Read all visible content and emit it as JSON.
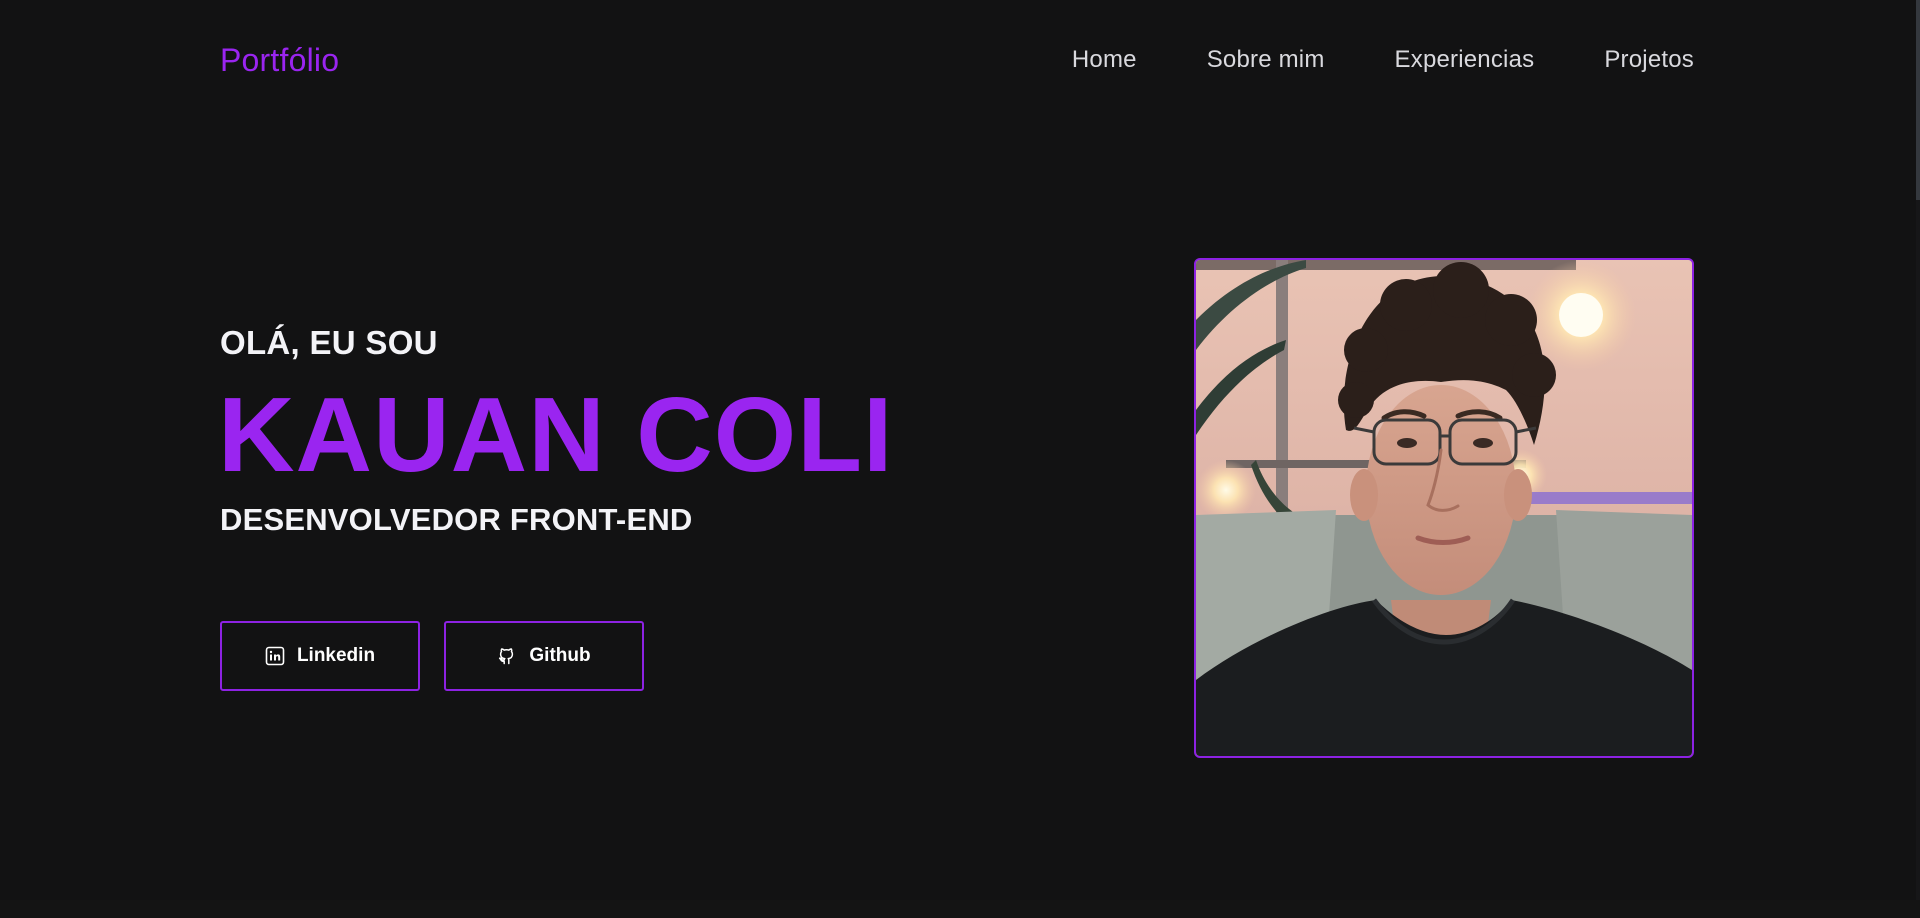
{
  "nav": {
    "brand": "Portfólio",
    "links": [
      {
        "label": "Home"
      },
      {
        "label": "Sobre mim"
      },
      {
        "label": "Experiencias"
      },
      {
        "label": "Projetos"
      }
    ]
  },
  "hero": {
    "greeting": "OLÁ, EU SOU",
    "name": "KAUAN COLI",
    "role": "DESENVOLVEDOR FRONT-END",
    "buttons": [
      {
        "label": "Linkedin",
        "icon": "linkedin-icon"
      },
      {
        "label": "Github",
        "icon": "github-icon"
      }
    ],
    "photo": {
      "icon": "profile-photo"
    }
  },
  "colors": {
    "background": "#121213",
    "accent": "#9a25f0",
    "text": "#f3f3f7"
  }
}
